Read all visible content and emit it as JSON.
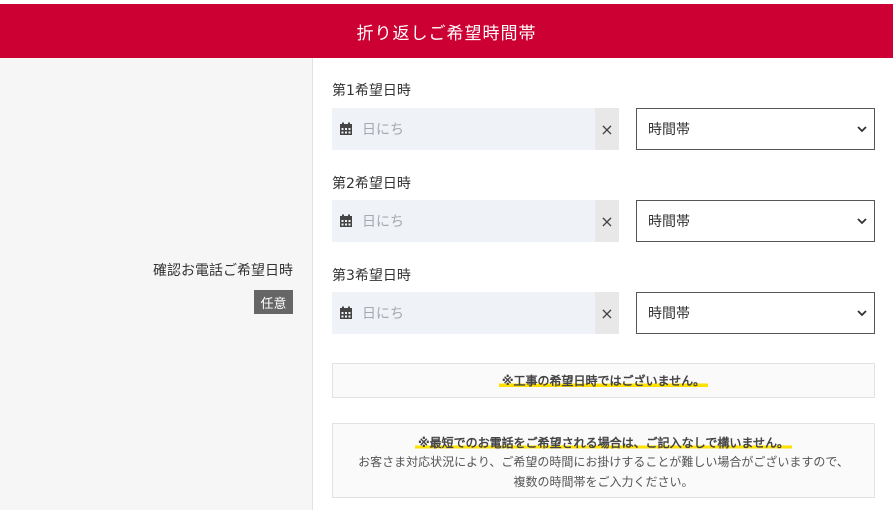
{
  "header": {
    "title": "折り返しご希望時間帯"
  },
  "field": {
    "label": "確認お電話ご希望日時",
    "badge": "任意"
  },
  "slots": [
    {
      "label": "第1希望日時",
      "date_placeholder": "日にち",
      "clear": "×",
      "time_value": "時間帯"
    },
    {
      "label": "第2希望日時",
      "date_placeholder": "日にち",
      "clear": "×",
      "time_value": "時間帯"
    },
    {
      "label": "第3希望日時",
      "date_placeholder": "日にち",
      "clear": "×",
      "time_value": "時間帯"
    }
  ],
  "notices": {
    "first": "※工事の希望日時ではございません。",
    "second_title": "※最短でのお電話をご希望される場合は、ご記入なしで構いません。",
    "second_line1": "お客さま対応状況により、ご希望の時間にお掛けすることが難しい場合がございますので、",
    "second_line2": "複数の時間帯をご入力ください。"
  },
  "colors": {
    "header_bg": "#cc0033",
    "highlight": "#ffe100",
    "date_field_bg": "#eff3f8",
    "badge_bg": "#666666"
  },
  "icons": {
    "calendar": "calendar-icon",
    "clear": "close-icon",
    "dropdown": "chevron-down-icon"
  }
}
